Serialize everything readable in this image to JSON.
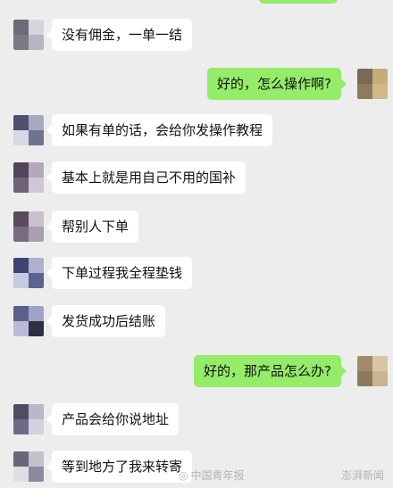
{
  "messages": [
    {
      "side": "left",
      "text": "没有佣金，一单一结",
      "avatar": [
        "#6f6a77",
        "#d8d4df",
        "#7d7886",
        "#b9b4c0"
      ]
    },
    {
      "side": "right",
      "text": "好的，怎么操作啊?",
      "avatar": [
        "#7a6a55",
        "#c4ad7a",
        "#8b7b5f",
        "#d1b98a"
      ]
    },
    {
      "side": "left",
      "text": "如果有单的话，会给你发操作教程",
      "avatar": [
        "#4d5270",
        "#a7a9bd",
        "#d7d9e4",
        "#6f7290"
      ]
    },
    {
      "side": "left",
      "text": "基本上就是用自己不用的国补",
      "avatar": [
        "#52445a",
        "#b5a8bb",
        "#6d6278",
        "#cfc6d6"
      ]
    },
    {
      "side": "left",
      "text": "帮别人下单",
      "avatar": [
        "#5b4a5e",
        "#c9bfcf",
        "#7a6b80",
        "#a99fb0"
      ]
    },
    {
      "side": "left",
      "text": "下单过程我全程垫钱",
      "avatar": [
        "#3f4370",
        "#aeb0cf",
        "#c8cae0",
        "#5e6290"
      ]
    },
    {
      "side": "left",
      "text": "发货成功后结账",
      "avatar": [
        "#5a5f8f",
        "#9fa3c8",
        "#b8bbd6",
        "#2f3045"
      ]
    },
    {
      "side": "right",
      "text": "好的，那产品怎么办?",
      "avatar": [
        "#a08c6c",
        "#d7c5a3",
        "#8d7a5c",
        "#c9b48e"
      ]
    },
    {
      "side": "left",
      "text": "产品会给你说地址",
      "avatar": [
        "#4f4d66",
        "#b9b7c9",
        "#6e6a86",
        "#d3d1de"
      ]
    },
    {
      "side": "left",
      "text": "等到地方了我来转寄",
      "avatar": [
        "#6a6578",
        "#c4c0cc",
        "#e0dde6",
        "#8e89a0"
      ]
    }
  ],
  "watermarks": {
    "left": "中国青年报",
    "right": "澎湃新闻",
    "left_icon": "weibo-icon"
  }
}
